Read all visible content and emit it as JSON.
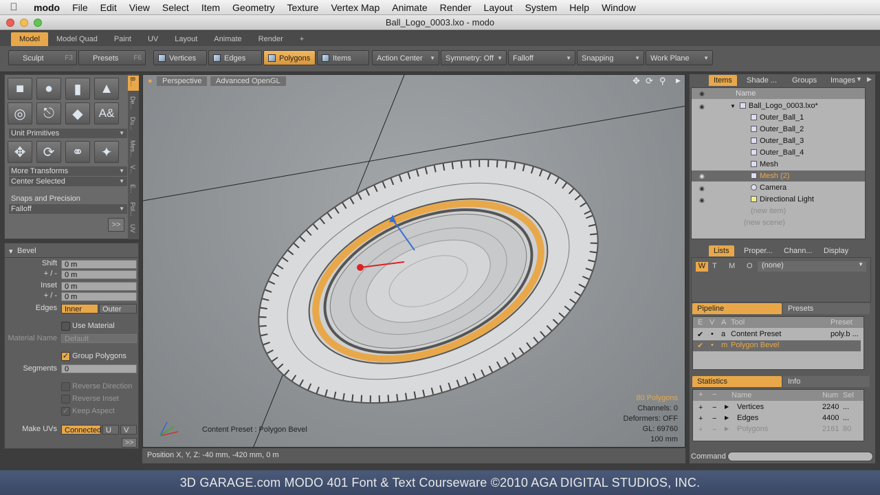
{
  "menubar": {
    "apple_icon": "apple-icon",
    "app_name": "modo",
    "items": [
      "File",
      "Edit",
      "View",
      "Select",
      "Item",
      "Geometry",
      "Texture",
      "Vertex Map",
      "Animate",
      "Render",
      "Layout",
      "System",
      "Help",
      "Window"
    ]
  },
  "window": {
    "title": "Ball_Logo_0003.lxo - modo"
  },
  "tabs": [
    "Model",
    "Model Quad",
    "Paint",
    "UV",
    "Layout",
    "Animate",
    "Render",
    "+"
  ],
  "toolbar": {
    "sculpt": "Sculpt",
    "sculpt_key": "F3",
    "presets": "Presets",
    "presets_key": "F6",
    "vertices": "Vertices",
    "edges": "Edges",
    "polygons": "Polygons",
    "items": "Items",
    "action_center": "Action Center",
    "symmetry": "Symmetry: Off",
    "falloff": "Falloff",
    "snapping": "Snapping",
    "work_plane": "Work Plane"
  },
  "left_tools": {
    "unit_primitives": "Unit Primitives",
    "more_transforms": "More Transforms",
    "center_selected": "Center Selected",
    "snaps": "Snaps and Precision",
    "falloff": "Falloff",
    "expand": ">>",
    "vtabs": [
      "B...",
      "De...",
      "Du...",
      "Mes...",
      "V...",
      "E...",
      "Pol...",
      "UV"
    ]
  },
  "bevel": {
    "title": "Bevel",
    "shift_label": "Shift",
    "shift": "0 m",
    "pm1_label": "+ / -",
    "pm1": "0 m",
    "inset_label": "Inset",
    "inset": "0 m",
    "pm2_label": "+ / -",
    "pm2": "0 m",
    "edges_label": "Edges",
    "inner": "Inner",
    "outer": "Outer",
    "use_material": "Use Material",
    "material_name_label": "Material Name",
    "material_name": "Default",
    "group_polygons": "Group Polygons",
    "segments_label": "Segments",
    "segments": "0",
    "reverse_direction": "Reverse Direction",
    "reverse_inset": "Reverse Inset",
    "keep_aspect": "Keep Aspect",
    "make_uvs_label": "Make UVs",
    "connected": "Connected",
    "u": "U",
    "v": "V",
    "expand": ">>"
  },
  "viewport": {
    "perspective": "Perspective",
    "shading": "Advanced OpenGL",
    "content_preset": "Content Preset : Polygon Bevel",
    "stats": {
      "polygons": "80 Polygons",
      "channels": "Channels: 0",
      "deformers": "Deformers: OFF",
      "gl": "GL: 69760",
      "scale": "100 mm"
    }
  },
  "status": {
    "position": "Position X, Y, Z:   -40 mm, -420 mm, 0 m"
  },
  "items_panel": {
    "tabs": [
      "Items",
      "Shade ...",
      "Groups",
      "Images"
    ],
    "name_header": "Name",
    "tree": [
      "Ball_Logo_0003.lxo*",
      "Outer_Ball_1",
      "Outer_Ball_2",
      "Outer_Ball_3",
      "Outer_Ball_4",
      "Mesh",
      "Mesh (2)",
      "Camera",
      "Directional Light",
      "(new item)",
      "(new scene)"
    ]
  },
  "lists_panel": {
    "tabs": [
      "Lists",
      "Proper...",
      "Chann...",
      "Display"
    ],
    "w": "W",
    "t": "T",
    "m": "M",
    "o": "O",
    "none": "(none)"
  },
  "pipeline": {
    "tabs": [
      "Pipeline",
      "Presets"
    ],
    "headers": [
      "E",
      "V",
      "A",
      "Tool",
      "Preset"
    ],
    "rows": [
      {
        "a": "a",
        "tool": "Content Preset",
        "preset": "poly.b ..."
      },
      {
        "a": "m",
        "tool": "Polygon Bevel",
        "preset": ""
      }
    ]
  },
  "statistics": {
    "tabs": [
      "Statistics",
      "Info"
    ],
    "headers": [
      "Name",
      "Num",
      "Sel"
    ],
    "rows": [
      {
        "name": "Vertices",
        "num": "2240",
        "sel": "..."
      },
      {
        "name": "Edges",
        "num": "4400",
        "sel": "..."
      },
      {
        "name": "Polygons",
        "num": "2161",
        "sel": "80"
      }
    ]
  },
  "command": {
    "label": "Command"
  },
  "footer": "3D GARAGE.com   MODO 401  Font & Text Courseware    ©2010  AGA DIGITAL STUDIOS, INC.",
  "colors": {
    "accent": "#e8a84a",
    "viewport_bg": "#8f9396",
    "footer_bg": "#3e4c6b"
  }
}
